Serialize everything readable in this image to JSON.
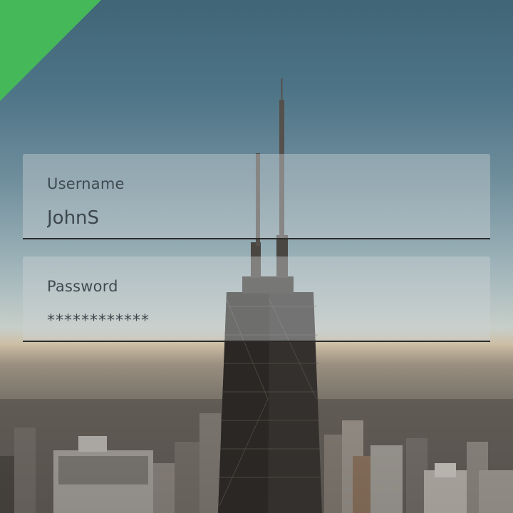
{
  "login_form": {
    "username": {
      "label": "Username",
      "value": "JohnS"
    },
    "password": {
      "label": "Password",
      "value": "************"
    }
  },
  "colors": {
    "accent": "#45b85a",
    "field_background": "#cdd2d4",
    "field_underline": "#2b2b2b",
    "text": "#3f4a52"
  }
}
